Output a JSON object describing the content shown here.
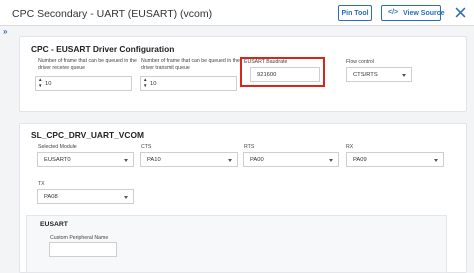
{
  "header": {
    "title": "CPC Secondary - UART (EUSART) (vcom)",
    "pin_tool_label": "Pin Tool",
    "view_source_label": "View Source",
    "view_source_icon": "code-icon",
    "close_icon": "close-icon"
  },
  "sidebar": {
    "toggle_icon": "double-chevron-right-icon",
    "toggle_glyph": "»"
  },
  "driver_config": {
    "title": "CPC - EUSART Driver Configuration",
    "rx_queue": {
      "label_line1": "Number of frame that can be queued in the",
      "label_line2": "driver receive queue",
      "value": "10"
    },
    "tx_queue": {
      "label_line1": "Number of frame that can be queued in the",
      "label_line2": "driver transmit queue",
      "value": "10"
    },
    "baudrate": {
      "label": "EUSART Baudrate",
      "value": "921600"
    },
    "flow_control": {
      "label": "Flow control",
      "value": "CTS/RTS"
    }
  },
  "vcom": {
    "title": "SL_CPC_DRV_UART_VCOM",
    "selected_module": {
      "label": "Selected Module",
      "value": "EUSART0"
    },
    "cts": {
      "label": "CTS",
      "value": "PA10"
    },
    "rts": {
      "label": "RTS",
      "value": "PA00"
    },
    "rx": {
      "label": "RX",
      "value": "PA09"
    },
    "tx": {
      "label": "TX",
      "value": "PA08"
    },
    "eusart": {
      "title": "EUSART",
      "custom_name_label": "Custom Peripheral Name",
      "custom_name_value": ""
    }
  },
  "colors": {
    "accent": "#2a6ebb",
    "highlight": "#d9261c",
    "background": "#f3f4f6"
  }
}
